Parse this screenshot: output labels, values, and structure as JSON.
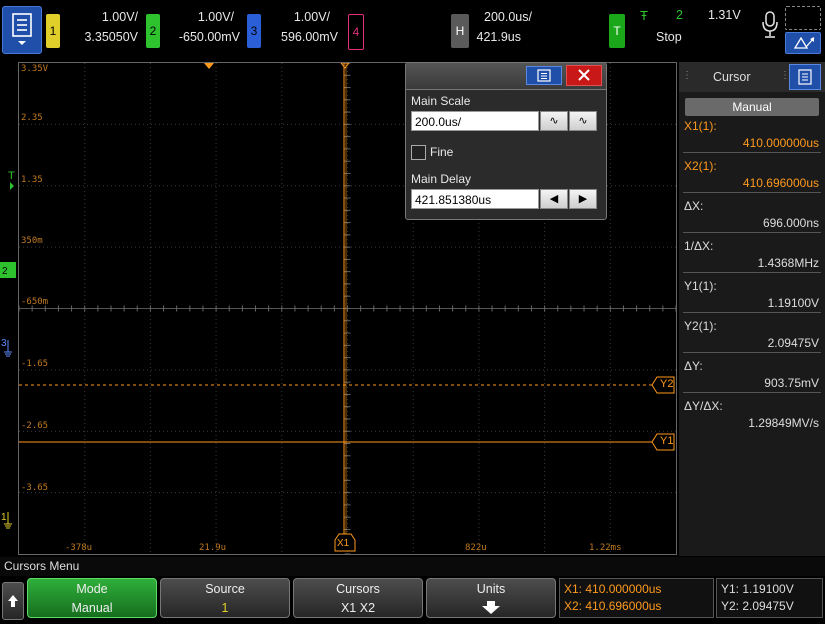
{
  "colors": {
    "ch1": "#e0cf2a",
    "ch2": "#2fc22f",
    "ch3": "#2b5fd8",
    "ch4": "#e0307a",
    "cursor": "#ff9a1e",
    "trigger": "#2fc22f"
  },
  "topbar": {
    "menu_icon": "menu-icon",
    "ch1": {
      "num": "1",
      "scale": "1.00V/",
      "offset": "3.35050V"
    },
    "ch2": {
      "num": "2",
      "scale": "1.00V/",
      "offset": "-650.00mV"
    },
    "ch3": {
      "num": "3",
      "scale": "1.00V/",
      "offset": "596.00mV"
    },
    "ch4": {
      "num": "4"
    },
    "horiz": {
      "badge": "H",
      "scale": "200.0us/",
      "delay": "421.9us"
    },
    "trigger": {
      "badge": "T",
      "edge": "Ŧ",
      "source": "2",
      "level": "1.31V",
      "status": "Stop"
    }
  },
  "grid": {
    "y_labels": [
      "3.35V",
      "2.35",
      "1.35",
      "350m",
      "-650m",
      "-1.65",
      "-2.65",
      "-3.65"
    ],
    "x_labels": [
      "-378u",
      "21.9u",
      "X1u",
      "822u",
      "1.22ms"
    ],
    "markers": {
      "y2": "Y2",
      "y1": "Y1",
      "x1": "X1"
    }
  },
  "dialog": {
    "main_scale_label": "Main Scale",
    "main_scale_value": "200.0us/",
    "fine_label": "Fine",
    "main_delay_label": "Main Delay",
    "main_delay_value": "421.851380us"
  },
  "cursor_panel": {
    "title": "Cursor",
    "mode": "Manual",
    "x1_label": "X1(1):",
    "x1_value": "410.000000us",
    "x2_label": "X2(1):",
    "x2_value": "410.696000us",
    "dx_label": "ΔX:",
    "dx_value": "696.000ns",
    "inv_dx_label": "1/ΔX:",
    "inv_dx_value": "1.4368MHz",
    "y1_label": "Y1(1):",
    "y1_value": "1.19100V",
    "y2_label": "Y2(1):",
    "y2_value": "2.09475V",
    "dy_label": "ΔY:",
    "dy_value": "903.75mV",
    "dydx_label": "ΔY/ΔX:",
    "dydx_value": "1.29849MV/s"
  },
  "bottom": {
    "menu_title": "Cursors Menu",
    "softkeys": [
      {
        "top": "Mode",
        "bottom": "Manual"
      },
      {
        "top": "Source",
        "bottom": "1"
      },
      {
        "top": "Cursors",
        "bottom": "X1 X2"
      },
      {
        "top": "Units",
        "bottom": ""
      }
    ],
    "readout": {
      "x1": "X1:  410.000000us",
      "x2": "X2:  410.696000us",
      "y1": "Y1: 1.19100V",
      "y2": "Y2: 2.09475V"
    }
  }
}
